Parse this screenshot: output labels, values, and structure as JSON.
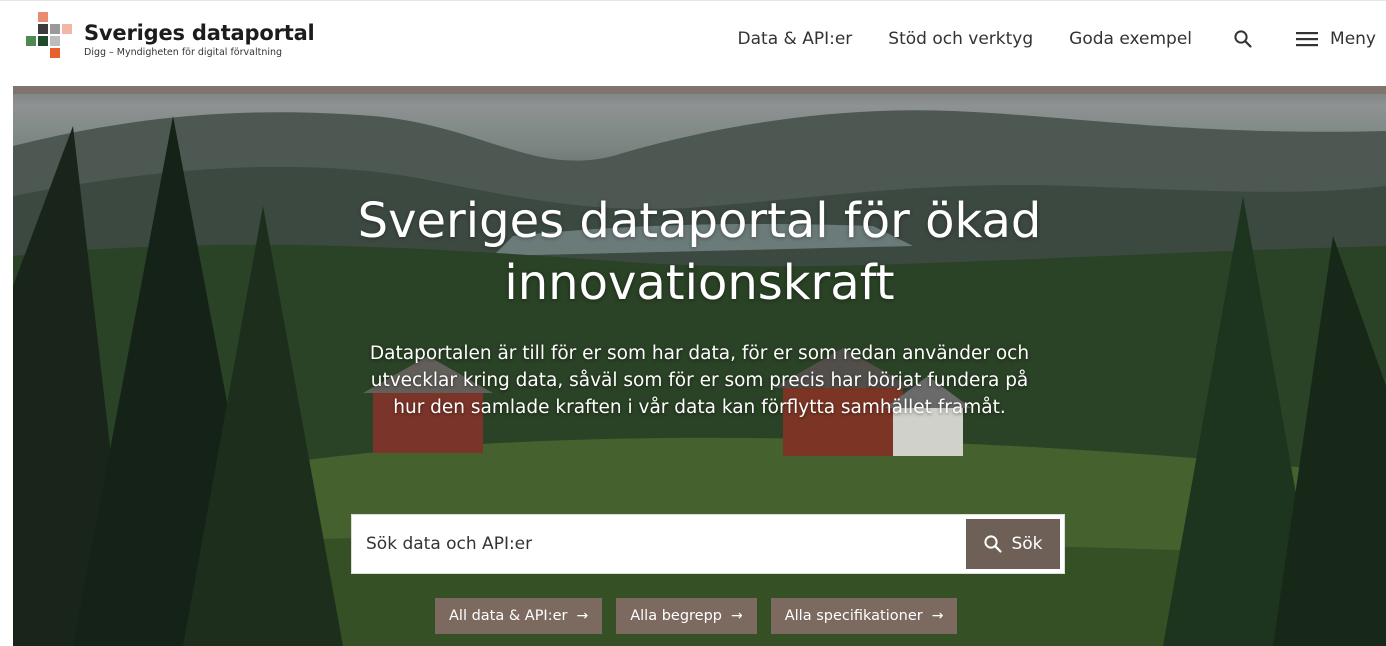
{
  "header": {
    "brand_name": "Sveriges dataportal",
    "brand_sub": "Digg – Myndigheten för digital förvaltning",
    "nav": [
      {
        "label": "Data & API:er"
      },
      {
        "label": "Stöd och verktyg"
      },
      {
        "label": "Goda exempel"
      }
    ],
    "menu_label": "Meny",
    "search_icon": "search-icon",
    "menu_icon": "hamburger-menu-icon"
  },
  "hero": {
    "title_line1": "Sveriges dataportal för ökad",
    "title_line2": "innovationskraft",
    "intro": "Dataportalen är till för er som har data, för er som redan använder och utvecklar kring data, såväl som för er som precis har börjat fundera på hur den samlade kraften i vår data kan förflytta samhället framåt.",
    "search": {
      "placeholder": "Sök data och API:er",
      "button_label": "Sök"
    },
    "quicklinks": [
      {
        "label": "All data & API:er"
      },
      {
        "label": "Alla begrepp"
      },
      {
        "label": "Alla specifikationer"
      }
    ]
  },
  "colors": {
    "brand_brown": "#6e5f57",
    "chip_brown": "#7c6a60",
    "logo_orange": "#e7612e",
    "logo_pink": "#f2b6a4"
  }
}
